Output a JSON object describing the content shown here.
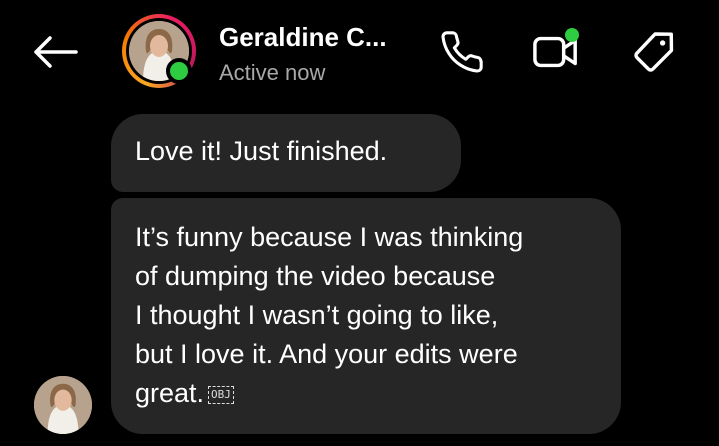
{
  "header": {
    "back_icon": "arrow-left-icon",
    "contact_name": "Geraldine C...",
    "status": "Active now",
    "status_color": "#2ecc40",
    "icons": [
      "phone-icon",
      "video-camera-icon",
      "tag-icon"
    ]
  },
  "messages": [
    {
      "text": "Love it! Just finished."
    },
    {
      "lines": [
        "It’s funny because I was thinking",
        "of dumping the video because",
        "I thought I wasn’t going to like,",
        "but I love it. And your edits were",
        "great."
      ],
      "obj_marker": "OBJ"
    }
  ],
  "theme": {
    "background": "#000000",
    "bubble": "#262626",
    "secondary_text": "#a8a8a8"
  }
}
